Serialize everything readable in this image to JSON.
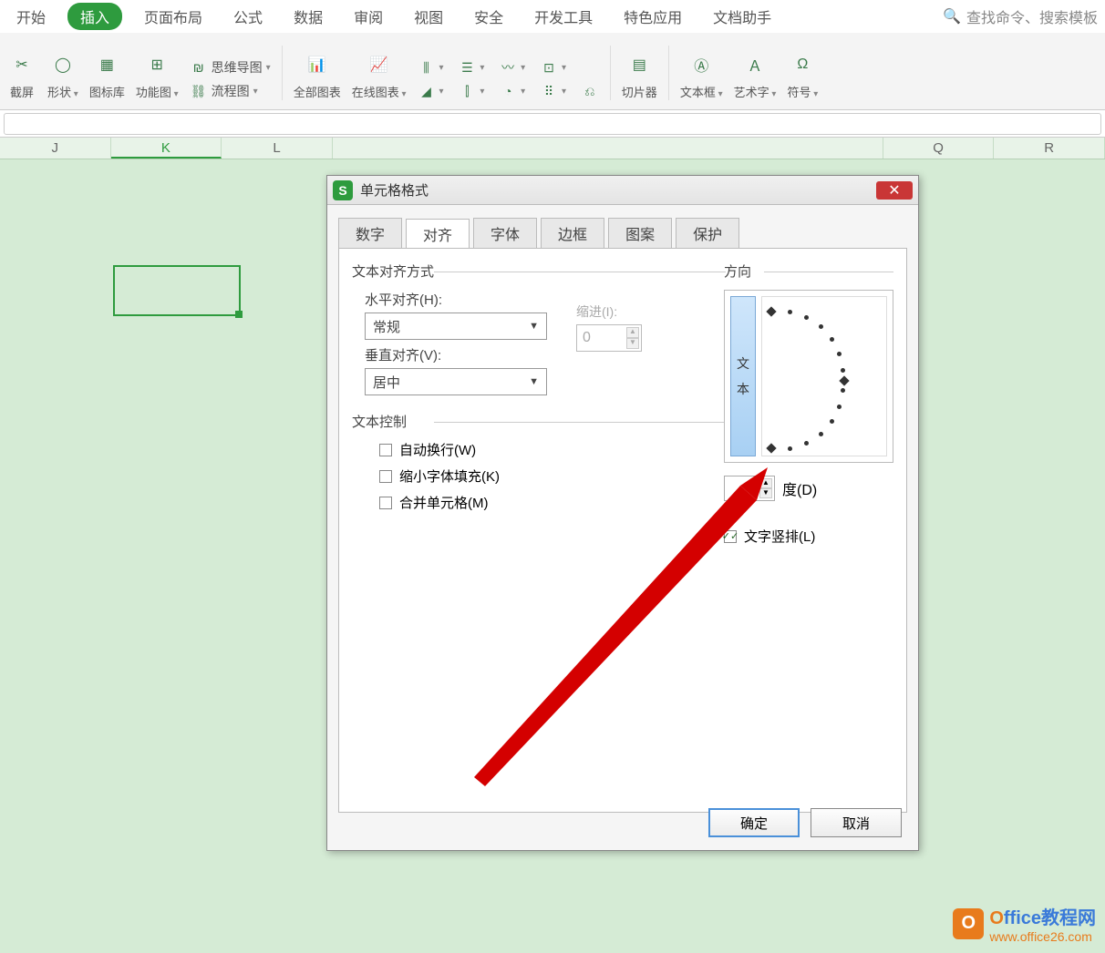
{
  "menu": {
    "items": [
      "开始",
      "插入",
      "页面布局",
      "公式",
      "数据",
      "审阅",
      "视图",
      "安全",
      "开发工具",
      "特色应用",
      "文档助手"
    ],
    "active_index": 1,
    "search_placeholder": "查找命令、搜索模板"
  },
  "toolbar": {
    "screenshot": "截屏",
    "shapes": "形状",
    "iconlib": "图标库",
    "smartart": "功能图",
    "mindmap": "思维导图",
    "flowchart": "流程图",
    "allcharts": "全部图表",
    "onlinecharts": "在线图表",
    "slicer": "切片器",
    "textbox": "文本框",
    "wordart": "艺术字",
    "symbol": "符号"
  },
  "columns": [
    "J",
    "K",
    "L",
    "Q",
    "R"
  ],
  "selected_column": "K",
  "dialog": {
    "title": "单元格格式",
    "tabs": [
      "数字",
      "对齐",
      "字体",
      "边框",
      "图案",
      "保护"
    ],
    "active_tab": 1,
    "section_align": "文本对齐方式",
    "h_align_label": "水平对齐(H):",
    "h_align_value": "常规",
    "indent_label": "缩进(I):",
    "indent_value": "0",
    "v_align_label": "垂直对齐(V):",
    "v_align_value": "居中",
    "section_control": "文本控制",
    "wrap": "自动换行(W)",
    "shrink": "缩小字体填充(K)",
    "merge": "合并单元格(M)",
    "section_orient": "方向",
    "orient_vert_text": "文本",
    "degree_label": "度(D)",
    "vertical_text": "文字竖排(L)",
    "ok": "确定",
    "cancel": "取消"
  },
  "watermark": {
    "brand": "Office教程网",
    "url": "www.office26.com"
  }
}
